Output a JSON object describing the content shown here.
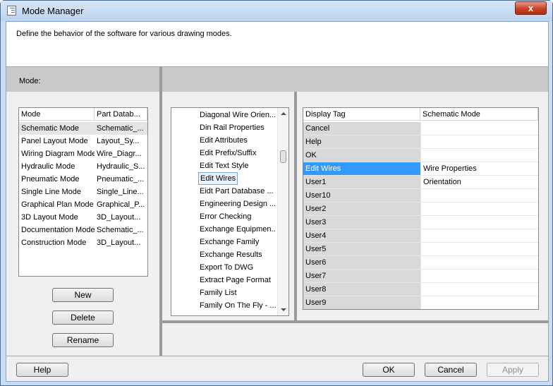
{
  "window": {
    "title": "Mode Manager",
    "close_glyph": "x"
  },
  "description": "Define the behavior of the software for various drawing modes.",
  "mode_label": "Mode:",
  "mode_table": {
    "columns": [
      "Mode",
      "Part Datab..."
    ],
    "rows": [
      [
        "Schematic Mode",
        "Schematic_..."
      ],
      [
        "Panel Layout Mode",
        "Layout_Sy..."
      ],
      [
        "Wiring Diagram Mode",
        "Wire_Diagr..."
      ],
      [
        "Hydraulic Mode",
        "Hydraulic_S..."
      ],
      [
        "Pneumatic Mode",
        "Pneumatic_..."
      ],
      [
        "Single Line Mode",
        "Single_Line..."
      ],
      [
        "Graphical Plan Mode",
        "Graphical_P..."
      ],
      [
        "3D Layout Mode",
        "3D_Layout..."
      ],
      [
        "Documentation Mode",
        "Schematic_..."
      ],
      [
        "Construction Mode",
        "3D_Layout..."
      ]
    ],
    "selected_index": 0
  },
  "mode_buttons": {
    "new": "New",
    "delete": "Delete",
    "rename": "Rename"
  },
  "function_list": {
    "items": [
      "Diagonal Wire Orien...",
      "Din Rail Properties",
      "Edit Attributes",
      "Edit Prefix/Suffix",
      "Edit Text Style",
      "Edit Wires",
      "Eidt Part Database ...",
      "Engineering Design ...",
      "Error Checking",
      "Exchange Equipmen...",
      "Exchange Family",
      "Exchange Results",
      "Export To DWG",
      "Extract Page Format",
      "Family List",
      "Family On The Fly - ..."
    ],
    "selected_index": 5
  },
  "tag_table": {
    "columns": [
      "Display Tag",
      "Schematic Mode"
    ],
    "rows": [
      [
        "Cancel",
        ""
      ],
      [
        "Help",
        ""
      ],
      [
        "OK",
        ""
      ],
      [
        "Edit Wires",
        "Wire Properties"
      ],
      [
        "User1",
        "Orientation"
      ],
      [
        "User10",
        ""
      ],
      [
        "User2",
        ""
      ],
      [
        "User3",
        ""
      ],
      [
        "User4",
        ""
      ],
      [
        "User5",
        ""
      ],
      [
        "User6",
        ""
      ],
      [
        "User7",
        ""
      ],
      [
        "User8",
        ""
      ],
      [
        "User9",
        ""
      ]
    ],
    "selected_index": 3
  },
  "footer": {
    "help": "Help",
    "ok": "OK",
    "cancel": "Cancel",
    "apply": "Apply"
  },
  "colors": {
    "selection": "#3399ff",
    "row_highlight": "#e5e5e5",
    "tag_cell": "#d9d9d9"
  }
}
